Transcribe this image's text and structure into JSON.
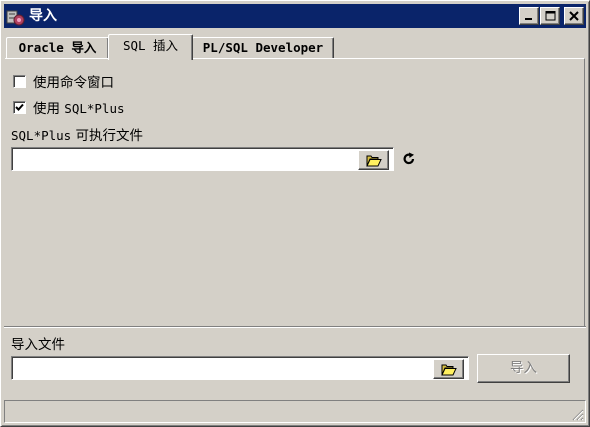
{
  "window": {
    "title": "导入",
    "title_bar_color": "#0a246a",
    "face_color": "#d4d0c8"
  },
  "tabs": [
    {
      "label": "Oracle 导入",
      "active": false
    },
    {
      "label": "SQL 插入",
      "active": true
    },
    {
      "label": "PL/SQL Developer",
      "active": false
    }
  ],
  "options": {
    "use_command_window": {
      "prefix": "使用命令窗口",
      "checked": false
    },
    "use_sqlplus": {
      "prefix": "使用",
      "suffix": "SQL*Plus",
      "checked": true
    }
  },
  "sqlplus_exe": {
    "label_mono": "SQL*Plus",
    "label_text": "可执行文件",
    "value": "",
    "browse_icon": "folder-open-icon",
    "refresh_icon": "refresh-icon"
  },
  "import_file": {
    "label": "导入文件",
    "value": "",
    "browse_icon": "folder-open-icon"
  },
  "import_button": {
    "label": "导入",
    "enabled": false
  }
}
